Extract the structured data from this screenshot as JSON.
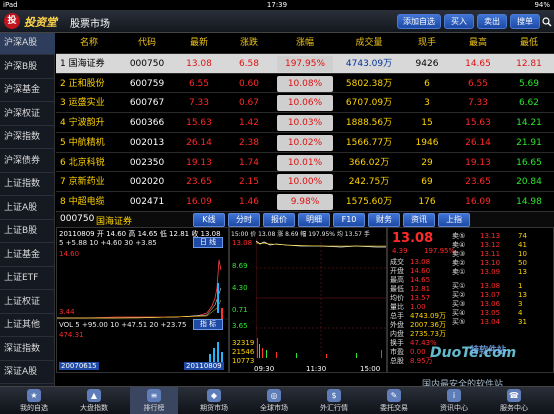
{
  "status_bar": {
    "carrier": "iPad",
    "time": "17:39",
    "battery": "94%"
  },
  "header": {
    "brand": "投资堂",
    "title": "股票市场",
    "buttons": [
      "添加自选",
      "买入",
      "卖出",
      "搜单"
    ],
    "search_icon": "search-icon"
  },
  "sidebar": {
    "items": [
      "沪深A股",
      "沪深B股",
      "沪深基金",
      "沪深权证",
      "沪深指数",
      "沪深债券",
      "上证指数",
      "上证A股",
      "上证B股",
      "上证基金",
      "上证ETF",
      "上证权证",
      "上证其他",
      "深证指数",
      "深证A股"
    ]
  },
  "table": {
    "headers": [
      "名称",
      "代码",
      "最新",
      "涨跌",
      "涨幅",
      "成交量",
      "现手",
      "最高",
      "最低"
    ],
    "rows": [
      {
        "name": "1 国海证券",
        "code": "000750",
        "last": "13.08",
        "chg": "6.58",
        "pct": "197.95%",
        "vol": "4743.09万",
        "cur": "9426",
        "high": "14.65",
        "low": "12.81"
      },
      {
        "name": "2 正和股份",
        "code": "600759",
        "last": "6.55",
        "chg": "0.60",
        "pct": "10.08%",
        "vol": "5802.38万",
        "cur": "6",
        "high": "6.55",
        "low": "5.69"
      },
      {
        "name": "3 运盛实业",
        "code": "600767",
        "last": "7.33",
        "chg": "0.67",
        "pct": "10.06%",
        "vol": "6707.09万",
        "cur": "3",
        "high": "7.33",
        "low": "6.62"
      },
      {
        "name": "4 宁波韵升",
        "code": "600366",
        "last": "15.63",
        "chg": "1.42",
        "pct": "10.03%",
        "vol": "1888.56万",
        "cur": "15",
        "high": "15.63",
        "low": "14.21"
      },
      {
        "name": "5 中航精机",
        "code": "002013",
        "last": "26.14",
        "chg": "2.38",
        "pct": "10.02%",
        "vol": "1566.77万",
        "cur": "1946",
        "high": "26.14",
        "low": "21.91"
      },
      {
        "name": "6 北京科锐",
        "code": "002350",
        "last": "19.13",
        "chg": "1.74",
        "pct": "10.01%",
        "vol": "366.02万",
        "cur": "29",
        "high": "19.13",
        "low": "16.65"
      },
      {
        "name": "7 京新药业",
        "code": "002020",
        "last": "23.65",
        "chg": "2.15",
        "pct": "10.00%",
        "vol": "242.75万",
        "cur": "69",
        "high": "23.65",
        "low": "20.84"
      },
      {
        "name": "8 中超电缆",
        "code": "002471",
        "last": "16.09",
        "chg": "1.46",
        "pct": "9.98%",
        "vol": "1575.60万",
        "cur": "176",
        "high": "16.09",
        "low": "14.98"
      }
    ]
  },
  "detail_tabs": {
    "code": "000750",
    "name": "国海证券",
    "items": [
      "K线",
      "分时",
      "报价",
      "明细",
      "F10",
      "财务",
      "资讯",
      "上指"
    ]
  },
  "kline": {
    "date_line": "20110809 开 14.60 高 14.65 低 12.81 收 13.08",
    "ma_line": "5 +5.88 10 +4.60 30 +3.85",
    "day_button": "日 线",
    "ind_button": "指 标",
    "price_top": "14.60",
    "price_low": "3.44",
    "vol_line": "VOL 5 +95.00 10 +47.51 20 +23.75",
    "vol_val": "474.31",
    "start_date": "20070615",
    "end_date": "20110809"
  },
  "minute": {
    "info_line": "15:00 价 13.08 涨 8.69 幅 197.95% 均 13.57 手",
    "prices": [
      "13.08",
      "8.69",
      "4.30",
      "0.71",
      "3.65"
    ],
    "vols": [
      "32319",
      "21546",
      "10773"
    ],
    "times": [
      "09:30",
      "11:30",
      "15:00"
    ],
    "avg_price": "13.08"
  },
  "order_book": {
    "last": "13.08",
    "pct": "197.95%",
    "change": "4.39",
    "asks": [
      [
        "卖⑤",
        "13.13",
        "74"
      ],
      [
        "卖④",
        "13.12",
        "41"
      ],
      [
        "卖③",
        "13.11",
        "10"
      ],
      [
        "卖②",
        "13.10",
        "50"
      ],
      [
        "卖①",
        "13.09",
        "13"
      ]
    ],
    "bids": [
      [
        "买①",
        "13.08",
        "1"
      ],
      [
        "买②",
        "13.07",
        "13"
      ],
      [
        "买③",
        "13.06",
        "3"
      ],
      [
        "买④",
        "13.05",
        "4"
      ],
      [
        "买⑤",
        "13.04",
        "31"
      ]
    ],
    "stats": [
      [
        "成交",
        "13.08"
      ],
      [
        "开盘",
        "14.60"
      ],
      [
        "最高",
        "14.65"
      ],
      [
        "最低",
        "12.81"
      ],
      [
        "均价",
        "13.57"
      ],
      [
        "量比",
        "1.00"
      ],
      [
        "总手",
        "4743.09万"
      ],
      [
        "外盘",
        "2007.36万"
      ],
      [
        "内盘",
        "2735.73万"
      ],
      [
        "换手",
        "47.43%"
      ],
      [
        "市盈",
        "0.00"
      ],
      [
        "总股",
        "8.95万"
      ]
    ]
  },
  "bottom_nav": {
    "items": [
      "我的自选",
      "大盘指数",
      "排行榜",
      "期货市场",
      "全球市场",
      "外汇行情",
      "委托交易",
      "资讯中心",
      "服务中心"
    ]
  },
  "watermark": {
    "line1": "DuoTe.com",
    "line2": "国内最安全的软件站",
    "line3": "特软件站"
  },
  "colors": {
    "up": "#ff2a2a",
    "down": "#2ee62e",
    "header_text": "#f0c419",
    "selected_row": "#d8d8d8",
    "button_blue": "#2f5fbf"
  }
}
